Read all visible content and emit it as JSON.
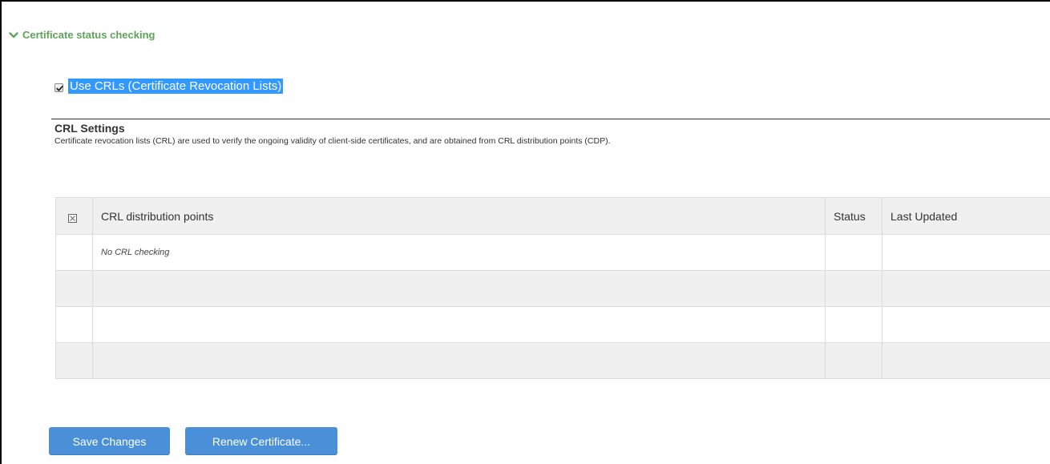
{
  "section": {
    "title": "Certificate status checking",
    "icon": "chevron-down-icon",
    "color": "#5fa35a"
  },
  "crl_option": {
    "label": "Use CRLs (Certificate Revocation Lists)",
    "checked": true
  },
  "crl_settings": {
    "title": "CRL Settings",
    "description": "Certificate revocation lists (CRL) are used to verify the ongoing validity of client-side certificates, and are obtained from CRL distribution points (CDP)."
  },
  "table": {
    "select_all_icon": "select-all-checkbox-icon",
    "columns": [
      "CRL distribution points",
      "Status",
      "Last Updated"
    ],
    "rows": [
      {
        "points": "No CRL checking",
        "status": "",
        "updated": ""
      },
      {
        "points": "",
        "status": "",
        "updated": ""
      },
      {
        "points": "",
        "status": "",
        "updated": ""
      },
      {
        "points": "",
        "status": "",
        "updated": ""
      }
    ]
  },
  "buttons": {
    "save": "Save Changes",
    "renew": "Renew Certificate..."
  },
  "colors": {
    "accent": "#4a90d9",
    "selection": "#3399ff"
  }
}
